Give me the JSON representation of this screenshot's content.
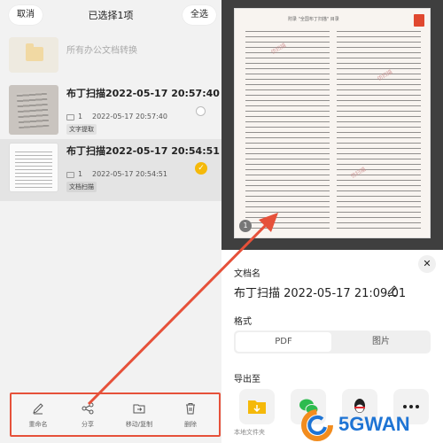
{
  "header": {
    "cancel_label": "取消",
    "title": "已选择1项",
    "select_all_label": "全选"
  },
  "folder": {
    "label": "所有办公文档转换"
  },
  "files": [
    {
      "name": "布丁扫描2022-05-17 20:57:40",
      "pages": "1",
      "date": "2022-05-17 20:57:40",
      "tag": "文字提取",
      "selected": false
    },
    {
      "name": "布丁扫描2022-05-17 20:54:51",
      "pages": "1",
      "date": "2022-05-17 20:54:51",
      "tag": "文档扫描",
      "selected": true
    }
  ],
  "toolbar": {
    "rename_label": "重命名",
    "share_label": "分享",
    "move_label": "移动/复制",
    "delete_label": "删除"
  },
  "preview": {
    "page_number": "1",
    "header_text": "附录 \"全国布丁扫描\" 目录",
    "watermark": "仿扫描"
  },
  "sheet": {
    "docname_label": "文档名",
    "docname": "布丁扫描 2022-05-17 21:09:01",
    "format_label": "格式",
    "format_options": [
      "PDF",
      "图片"
    ],
    "format_selected": "PDF",
    "export_label": "导出至",
    "export_targets": [
      "folder-icon",
      "wechat-icon",
      "qq-icon",
      "more-icon"
    ],
    "local_folder_label": "本地文件夹"
  },
  "brand": {
    "text": "5GWAN"
  },
  "colors": {
    "accent": "#f5b90a",
    "highlight": "#e6513a",
    "brand": "#1e74d4"
  }
}
